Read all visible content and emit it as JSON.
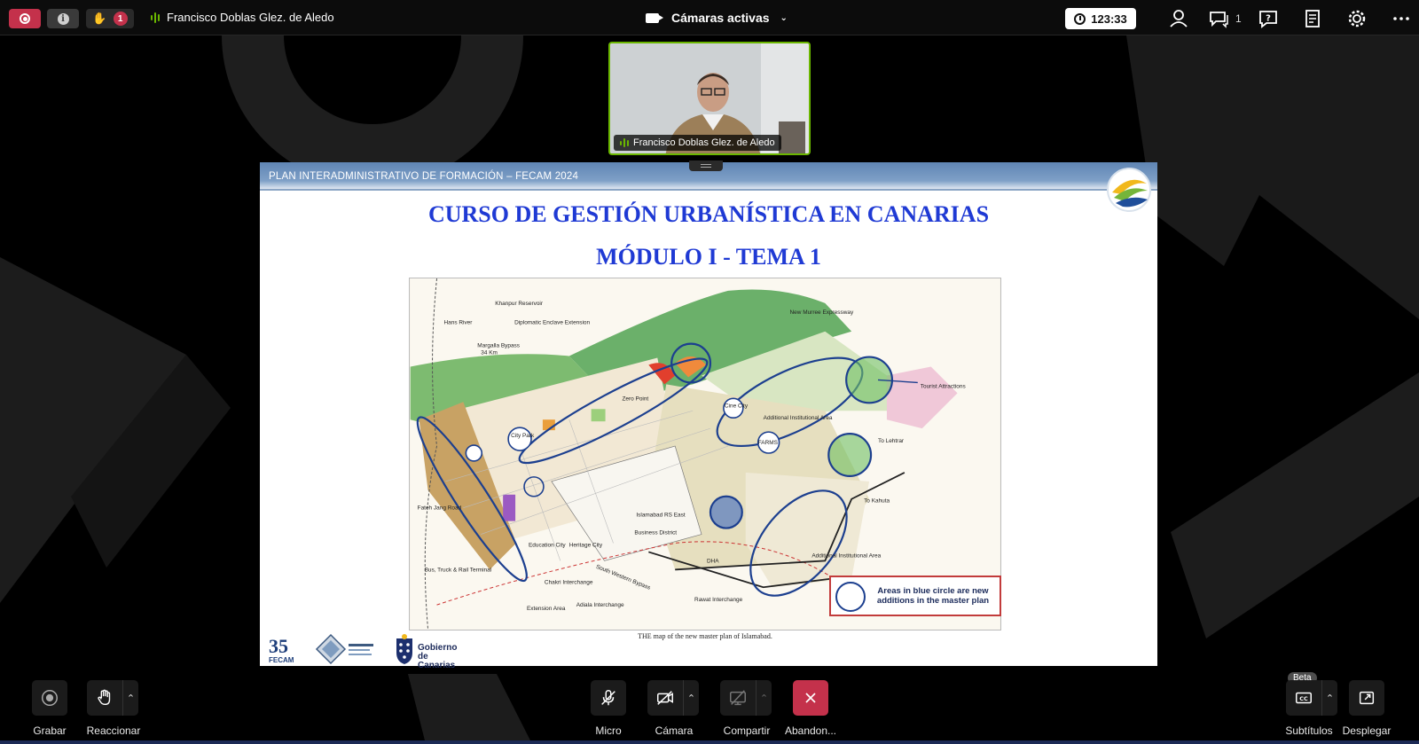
{
  "topbar": {
    "raised_hands_count": "1",
    "speaker_name": "Francisco Doblas Glez. de Aledo",
    "view_label": "Cámaras activas",
    "timer": "123:33",
    "chat_count": "1"
  },
  "video_tile": {
    "name": "Francisco Doblas Glez. de Aledo"
  },
  "slide": {
    "header": "PLAN INTERADMINISTRATIVO DE FORMACIÓN – FECAM 2024",
    "title": "CURSO DE GESTIÓN URBANÍSTICA EN CANARIAS",
    "subtitle": "MÓDULO I - TEMA 1",
    "map_caption": "THE map of the new master plan of Islamabad.",
    "legend_text": "Areas in blue circle are new additions in the master plan",
    "fecam_number": "35",
    "fecam_text": "FECAM",
    "gobierno_line1": "Gobierno",
    "gobierno_line2": "de Canarias",
    "map_labels": {
      "khanpur": "Khanpur Reservoir",
      "hans_river": "Hans River",
      "diplomatic": "Diplomatic Enclave Extension",
      "margalla": "Margalla Bypass",
      "margalla_km": "34 Km",
      "expressway": "New Murree Expressway",
      "tourist": "Tourist Attractions",
      "institutional": "Additional Institutional Area",
      "institutional2": "Additional Institutional Area",
      "city_park": "City Park",
      "cine_city": "Cine City",
      "farms": "FARMS",
      "zero_point": "Zero Point",
      "business": "Business District",
      "education": "Education City",
      "heritage": "Heritage City",
      "bus_terminal": "Bus, Truck & Rail Terminal",
      "extension": "Extension Area",
      "islamabad_rs": "Islamabad RS East",
      "lehtrar": "To Lehtrar",
      "kahuta": "To Kahuta",
      "fateh_jang": "Fateh Jang Road",
      "chakri": "Chakri Interchange",
      "adiala": "Adiala Interchange",
      "rawat": "Rawat Interchange",
      "south_bypass": "South Western Bypass",
      "dha": "DHA"
    }
  },
  "controls": {
    "record": "Grabar",
    "react": "Reaccionar",
    "mic": "Micro",
    "camera": "Cámara",
    "share": "Compartir",
    "leave": "Abandon...",
    "captions": "Subtítulos",
    "captions_badge": "Beta",
    "expand": "Desplegar"
  },
  "colors": {
    "accent_red": "#c4314b",
    "speaking_green": "#6bb700",
    "slide_title_blue": "#1f3ad4"
  }
}
